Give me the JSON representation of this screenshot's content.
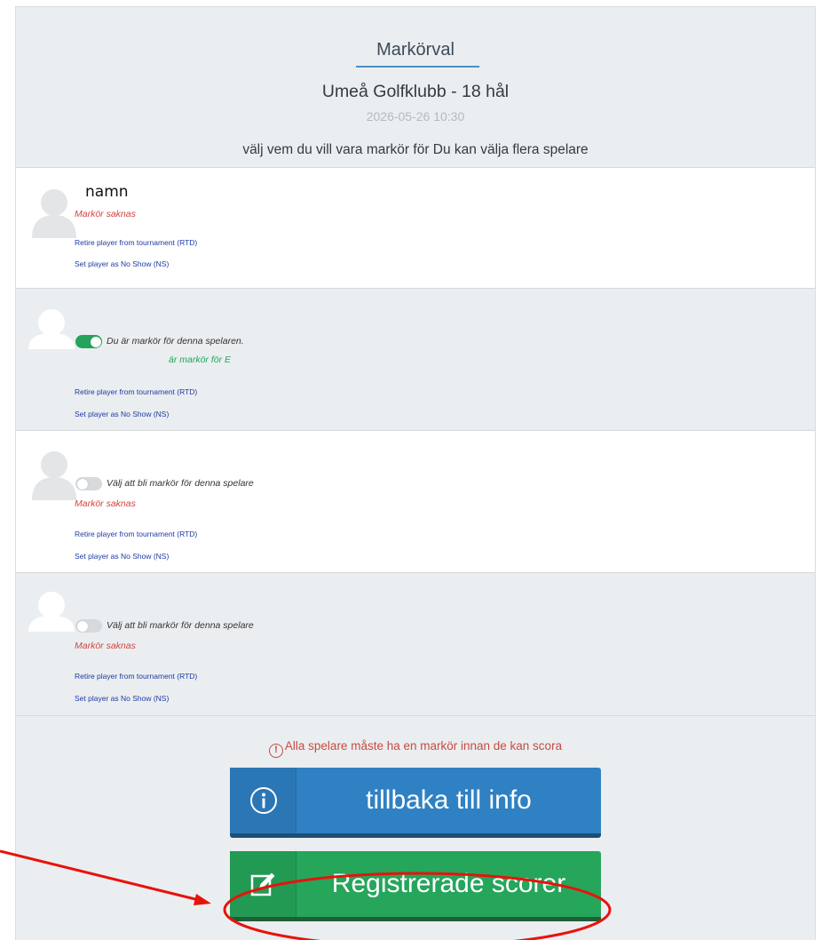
{
  "header": {
    "title": "Markörval",
    "course": "Umeå Golfklubb - 18 hål",
    "datetime": "2026-05-26 10:30",
    "instruction": "välj vem du vill vara markör för Du kan välja flera spelare"
  },
  "players": [
    {
      "name": "namn",
      "status": "Markör saknas",
      "retire_link": "Retire player from tournament (RTD)",
      "noshow_link": "Set player as No Show (NS)"
    },
    {
      "toggle_on": true,
      "toggle_label": "Du är markör för denna spelaren.",
      "marker_for": "är markör för E",
      "retire_link": "Retire player from tournament (RTD)",
      "noshow_link": "Set player as No Show (NS)"
    },
    {
      "toggle_on": false,
      "toggle_label": "Välj att bli markör för denna spelare",
      "status": "Markör saknas",
      "retire_link": "Retire player from tournament (RTD)",
      "noshow_link": "Set player as No Show (NS)"
    },
    {
      "toggle_on": false,
      "toggle_label": "Välj att bli markör för denna spelare",
      "status": "Markör saknas",
      "retire_link": "Retire player from tournament (RTD)",
      "noshow_link": "Set player as No Show (NS)"
    }
  ],
  "footer": {
    "warning_icon": "!",
    "warning": "Alla spelare måste ha en markör innan de kan scora",
    "back_button": {
      "icon": "info-icon",
      "label": "tillbaka till info"
    },
    "score_button": {
      "icon": "edit-icon",
      "label": "Registrerade scorer"
    }
  },
  "colors": {
    "primary_blue": "#2f81c4",
    "success_green": "#25a65b",
    "error_red": "#d0463f",
    "annotation_red": "#e8120c"
  }
}
